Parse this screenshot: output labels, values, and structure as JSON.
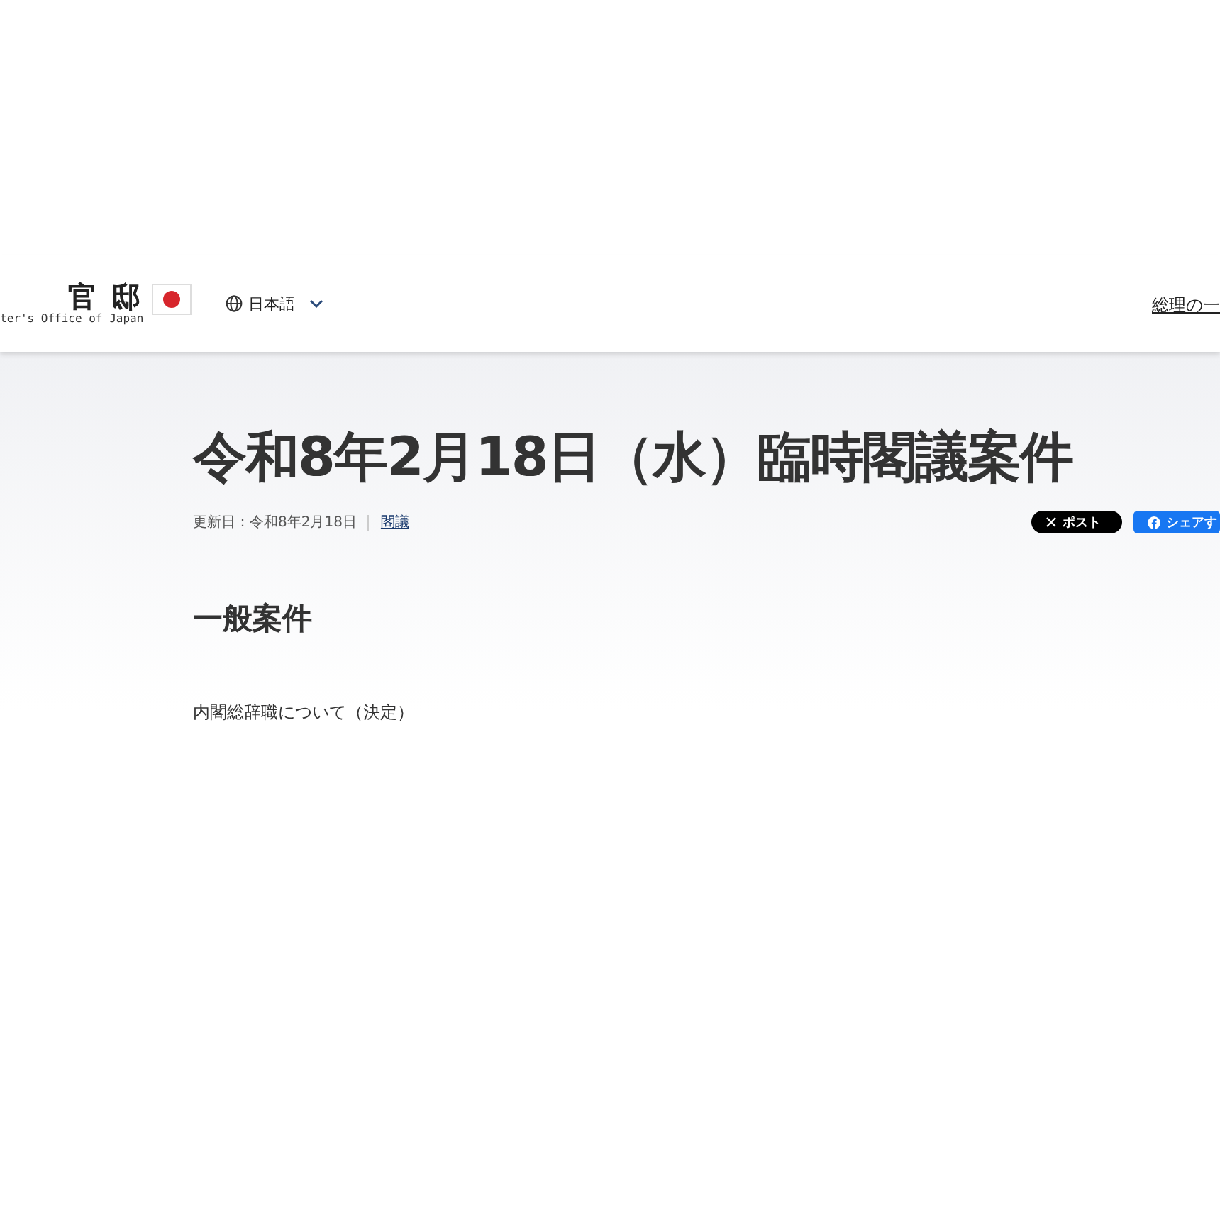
{
  "header": {
    "logo_title": "官 邸",
    "logo_subtitle": "ter's Office of Japan",
    "language": "日本語",
    "nav_link": "総理の一"
  },
  "article": {
    "title": "令和8年2月18日（水）臨時閣議案件",
    "updated": "更新日：令和8年2月18日",
    "category": "閣議",
    "share_buttons": [
      {
        "kind": "x",
        "label": "ポスト"
      },
      {
        "kind": "facebook",
        "label": "シェアす"
      }
    ],
    "sections": [
      {
        "heading": "一般案件",
        "items": [
          "内閣総辞職について（決定）"
        ]
      }
    ]
  }
}
